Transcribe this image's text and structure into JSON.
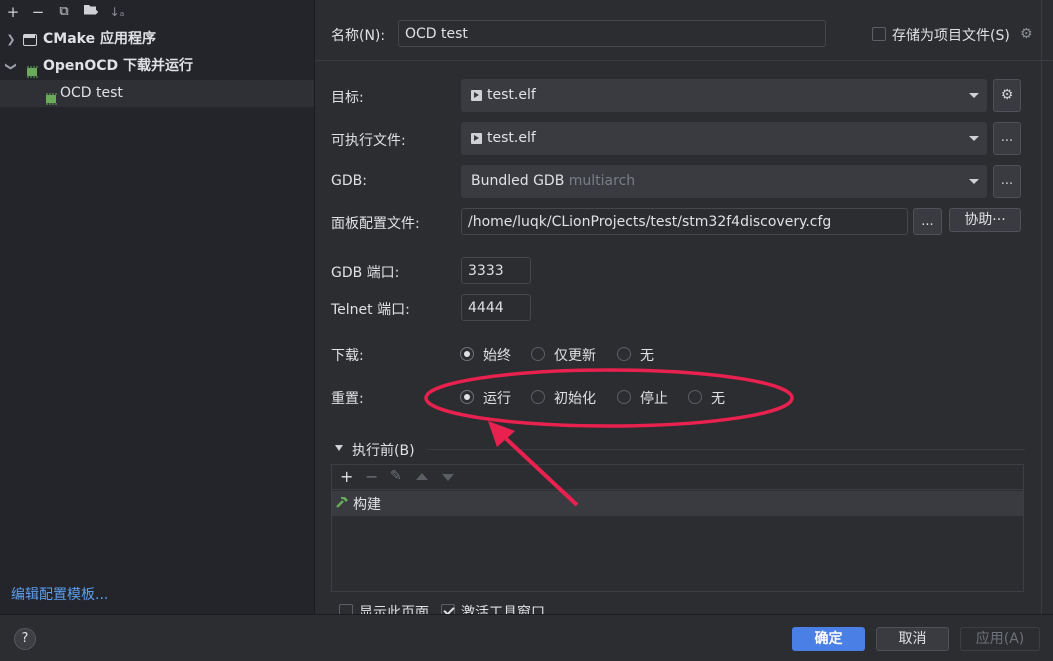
{
  "left": {
    "toolbar": [
      "+",
      "−",
      "⧉",
      "▸",
      "↓ₐ"
    ],
    "tree": [
      {
        "label": "CMake 应用程序",
        "expanded": false
      },
      {
        "label": "OpenOCD 下载并运行",
        "expanded": true
      },
      {
        "label": "OCD test",
        "selected": true
      }
    ],
    "edit_templates_link": "编辑配置模板..."
  },
  "form": {
    "name_label": "名称(N):",
    "name_value": "OCD test",
    "store_as_project": "存储为项目文件(S)",
    "target_label": "目标:",
    "target_value": "test.elf",
    "executable_label": "可执行文件:",
    "executable_value": "test.elf",
    "gdb_label": "GDB:",
    "gdb_value": "Bundled GDB",
    "gdb_hint": "multiarch",
    "board_label": "面板配置文件:",
    "board_value": "/home/luqk/CLionProjects/test/stm32f4discovery.cfg",
    "browse": "...",
    "assist": "协助···",
    "gdb_port_label": "GDB 端口:",
    "gdb_port": "3333",
    "telnet_port_label": "Telnet 端口:",
    "telnet_port": "4444",
    "download_label": "下载:",
    "download_options": [
      "始终",
      "仅更新",
      "无"
    ],
    "download_selected": 0,
    "reset_label": "重置:",
    "reset_options": [
      "运行",
      "初始化",
      "停止",
      "无"
    ],
    "reset_selected": 0,
    "before_launch": "执行前(B)",
    "before_tasks": [
      "构建"
    ],
    "show_page": "显示此页面",
    "activate_tool": "激活工具窗口"
  },
  "footer": {
    "help": "?",
    "ok": "确定",
    "cancel": "取消",
    "apply": "应用(A)"
  },
  "colors": {
    "accent": "#4a80e6",
    "annotation": "#e8214f"
  }
}
